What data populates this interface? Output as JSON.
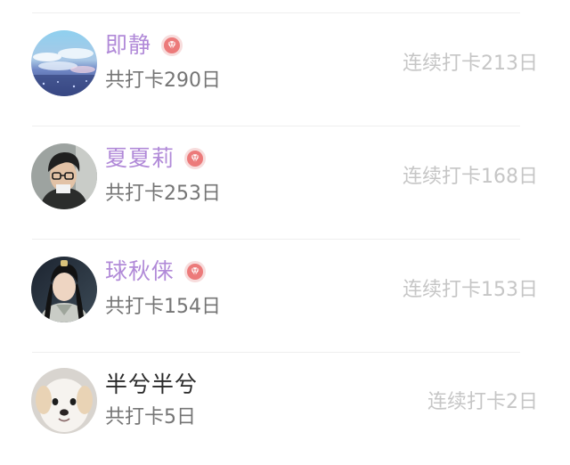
{
  "members": [
    {
      "name": "即静",
      "vip": true,
      "total": "共打卡290日",
      "streak": "连续打卡213日",
      "avatar_icon": "sky-clouds-avatar"
    },
    {
      "name": "夏夏莉",
      "vip": true,
      "total": "共打卡253日",
      "streak": "连续打卡168日",
      "avatar_icon": "person-glasses-avatar"
    },
    {
      "name": "球秋俫",
      "vip": true,
      "total": "共打卡154日",
      "streak": "连续打卡153日",
      "avatar_icon": "costume-actor-avatar"
    },
    {
      "name": "半兮半兮",
      "vip": false,
      "total": "共打卡5日",
      "streak": "连续打卡2日",
      "avatar_icon": "white-dog-avatar"
    }
  ],
  "colors": {
    "vip_name": "#b18ad8",
    "plain_name": "#2a2a2a",
    "badge": "#ec7a7a",
    "total_text": "#757575",
    "streak_text": "#c6c6c6",
    "divider": "#eeeeee"
  }
}
